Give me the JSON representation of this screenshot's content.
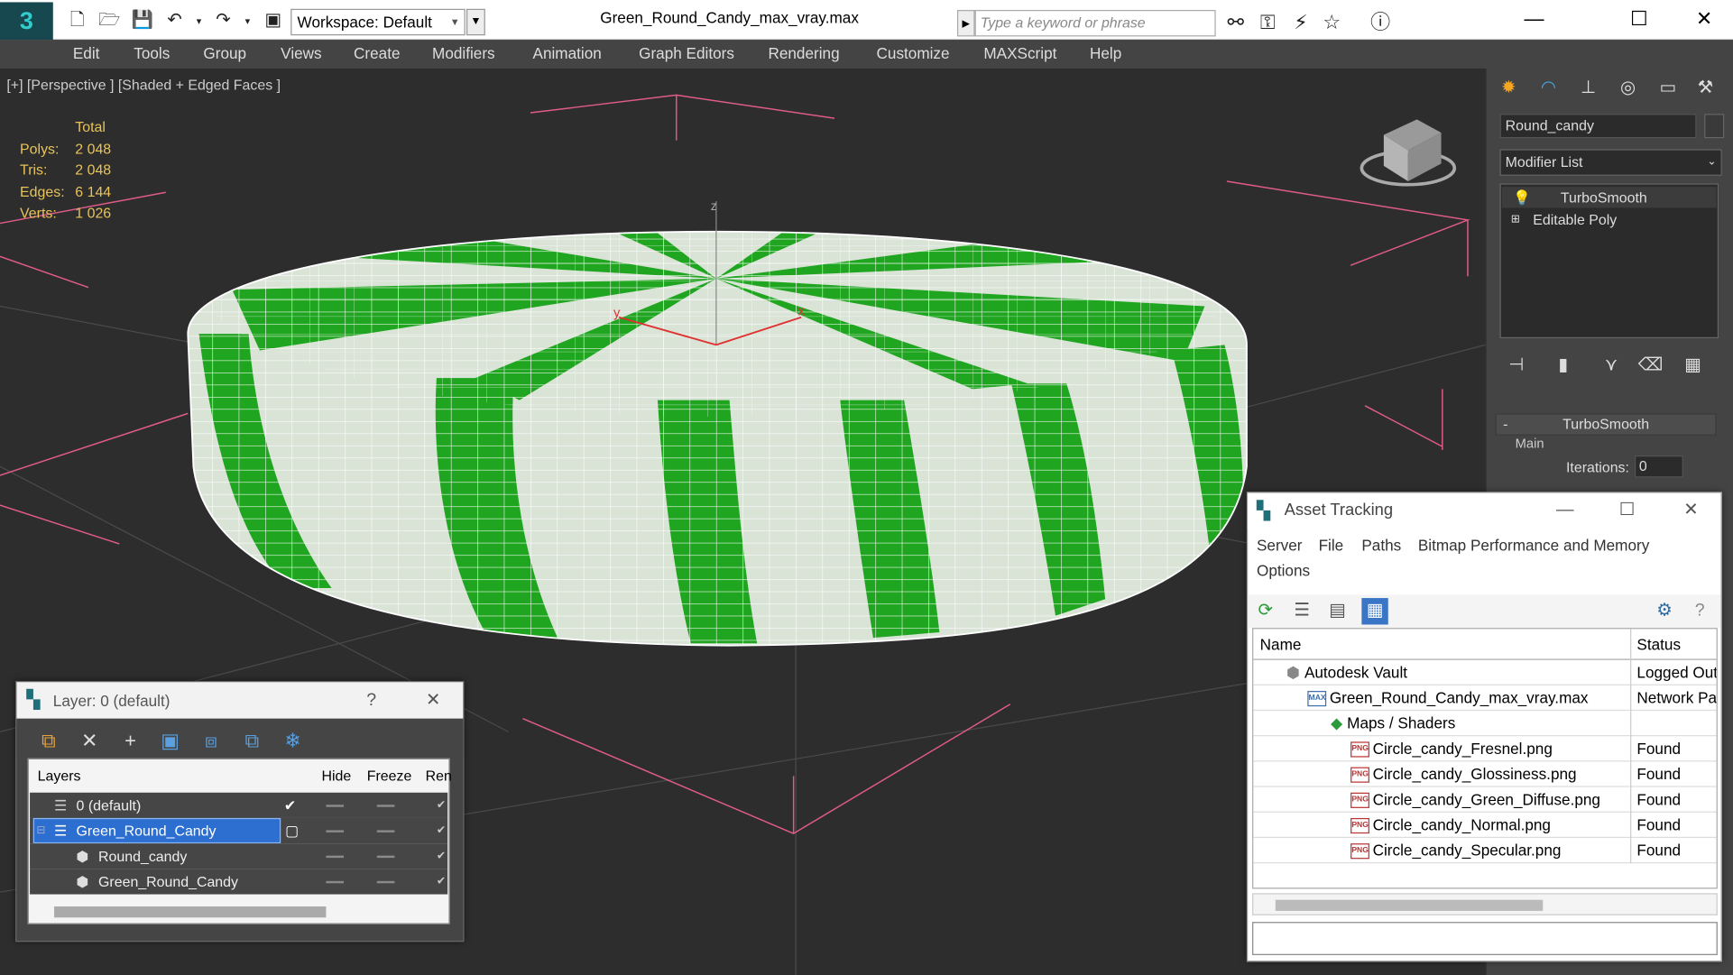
{
  "window": {
    "title": "Green_Round_Candy_max_vray.max",
    "workspace_label": "Workspace: Default",
    "search_placeholder": "Type a keyword or phrase",
    "app_logo_text": "3"
  },
  "menu": [
    "Edit",
    "Tools",
    "Group",
    "Views",
    "Create",
    "Modifiers",
    "Animation",
    "Graph Editors",
    "Rendering",
    "Customize",
    "MAXScript",
    "Help"
  ],
  "viewport": {
    "label": "[+] [Perspective ] [Shaded + Edged Faces ]",
    "stats_header": "Total",
    "stats": [
      {
        "key": "Polys:",
        "value": "2 048"
      },
      {
        "key": "Tris:",
        "value": "2 048"
      },
      {
        "key": "Edges:",
        "value": "6 144"
      },
      {
        "key": "Verts:",
        "value": "1 026"
      }
    ],
    "axis_x": "x",
    "axis_y": "y",
    "axis_z": "z",
    "candy_colors": {
      "stripe": "#1fa51f",
      "base": "#dde6da",
      "wire": "#ffffff"
    }
  },
  "command_panel": {
    "object_name": "Round_candy",
    "modifier_list_label": "Modifier List",
    "stack": [
      "TurboSmooth",
      "Editable Poly"
    ],
    "rollout_title": "TurboSmooth",
    "group_label": "Main",
    "iterations_label": "Iterations:",
    "iterations_value": "0"
  },
  "asset_tracking": {
    "title": "Asset Tracking",
    "menu": [
      "Server",
      "File",
      "Paths",
      "Bitmap Performance and Memory",
      "Options"
    ],
    "columns": {
      "name": "Name",
      "status": "Status"
    },
    "rows": [
      {
        "name": "Autodesk Vault",
        "status": "Logged Out"
      },
      {
        "name": "Green_Round_Candy_max_vray.max",
        "status": "Network Pat"
      },
      {
        "name": "Maps / Shaders",
        "status": ""
      },
      {
        "name": "Circle_candy_Fresnel.png",
        "status": "Found"
      },
      {
        "name": "Circle_candy_Glossiness.png",
        "status": "Found"
      },
      {
        "name": "Circle_candy_Green_Diffuse.png",
        "status": "Found"
      },
      {
        "name": "Circle_candy_Normal.png",
        "status": "Found"
      },
      {
        "name": "Circle_candy_Specular.png",
        "status": "Found"
      }
    ]
  },
  "layer_window": {
    "title": "Layer: 0 (default)",
    "help": "?",
    "columns": {
      "layers": "Layers",
      "hide": "Hide",
      "freeze": "Freeze",
      "render": "Ren"
    },
    "rows": [
      {
        "name": "0 (default)"
      },
      {
        "name": "Green_Round_Candy"
      },
      {
        "name": "Round_candy"
      },
      {
        "name": "Green_Round_Candy"
      }
    ]
  }
}
